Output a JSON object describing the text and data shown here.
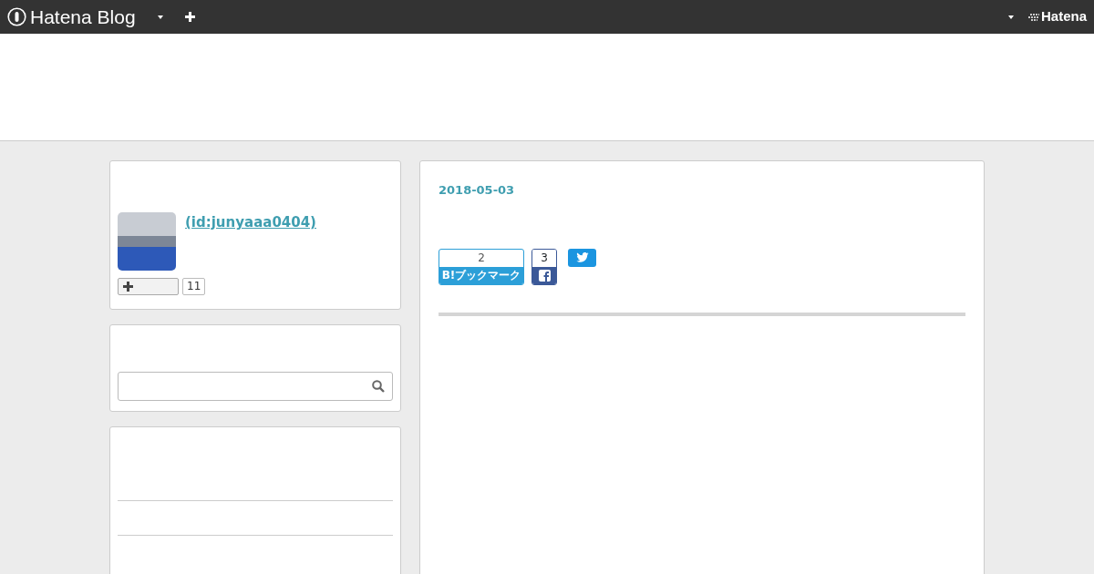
{
  "header": {
    "logo": "Hatena Blog",
    "brand": "Hatena"
  },
  "profile": {
    "id_link": "(id:junyaaa0404)",
    "subscriber_count": "11"
  },
  "article": {
    "date": "2018-05-03",
    "bookmark_count": "2",
    "bookmark_label": "B!ブックマーク",
    "facebook_count": "3"
  }
}
